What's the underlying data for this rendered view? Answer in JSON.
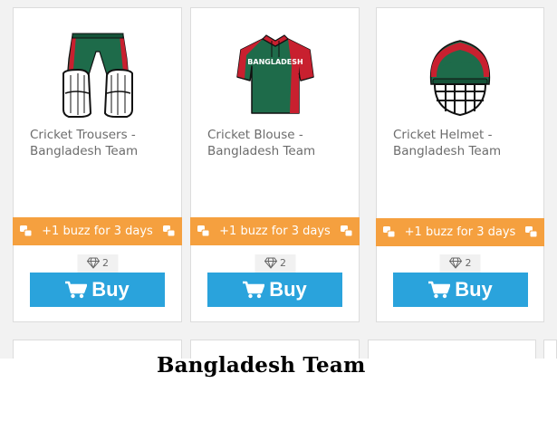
{
  "products": [
    {
      "title": "Cricket Trousers - Bangladesh Team",
      "image_icon": "cricket-trousers-icon",
      "promo": "+1 buzz for 3 days",
      "price": "2",
      "buy_label": "Buy"
    },
    {
      "title": "Cricket Blouse - Bangladesh Team",
      "image_icon": "cricket-blouse-icon",
      "shirt_text": "BANGLADESH",
      "promo": "+1 buzz for 3 days",
      "price": "2",
      "buy_label": "Buy"
    },
    {
      "title": "Cricket Helmet - Bangladesh Team",
      "image_icon": "cricket-helmet-icon",
      "promo": "+1 buzz for 3 days",
      "price": "2",
      "buy_label": "Buy"
    }
  ],
  "caption": "Bangladesh Team",
  "colors": {
    "promo_banner": "#f5a03f",
    "buy_button": "#2aa3dc",
    "team_green": "#1e6b4a",
    "team_red": "#c8202f"
  }
}
